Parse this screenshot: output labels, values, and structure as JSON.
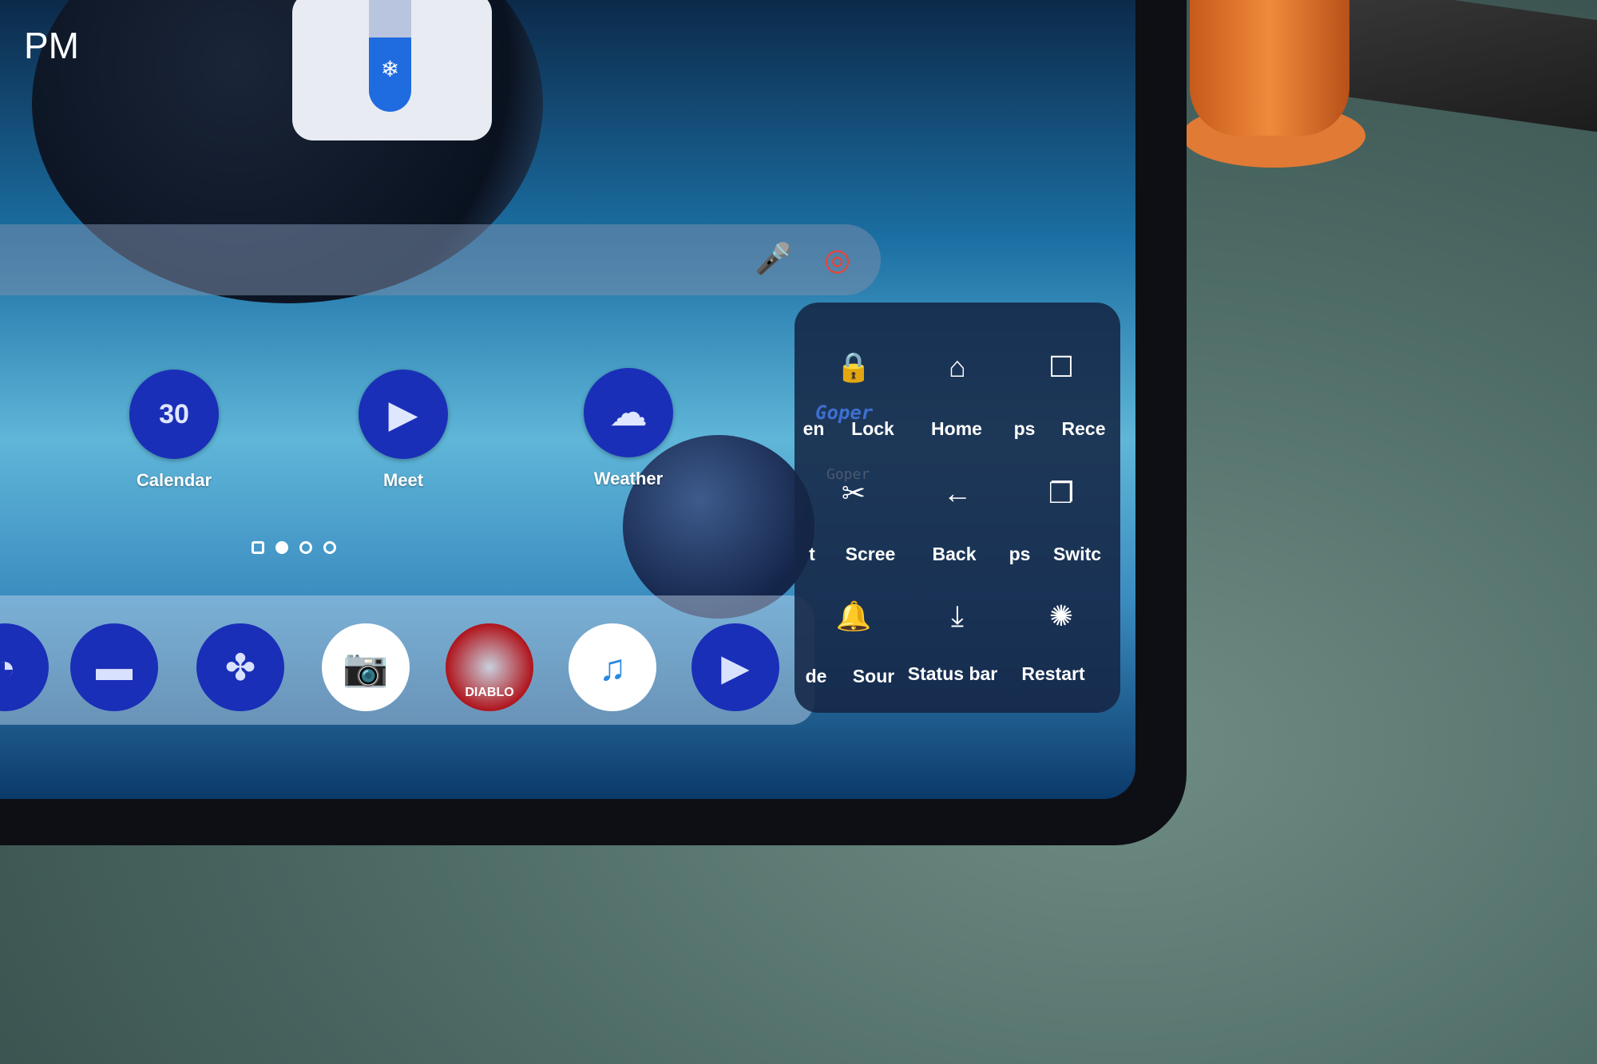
{
  "status": {
    "time_suffix": "PM"
  },
  "widget": {
    "icon_top": "leaf-icon",
    "icon_bottom": "snowflake-icon",
    "glyph": "❄"
  },
  "search": {
    "mic_icon": "microphone-icon",
    "lens_icon": "google-lens-icon",
    "mic_glyph": "🎤",
    "lens_glyph": "◎"
  },
  "apps": [
    {
      "label": "Calendar",
      "icon": "calendar-icon",
      "glyph": "30"
    },
    {
      "label": "Meet",
      "icon": "video-camera-icon",
      "glyph": "▶"
    },
    {
      "label": "Weather",
      "icon": "cloud-icon",
      "glyph": "☁"
    }
  ],
  "page_indicator": {
    "pages": 4,
    "current": 2
  },
  "dock": [
    {
      "icon": "chrome-icon",
      "glyph": "◔"
    },
    {
      "icon": "folder-icon",
      "glyph": "▬"
    },
    {
      "icon": "pinwheel-icon",
      "glyph": "✤"
    },
    {
      "icon": "camera-icon",
      "glyph": "📷"
    },
    {
      "icon": "diablo-game-icon",
      "glyph": "DIABLO"
    },
    {
      "icon": "app-folder-icon",
      "glyph": "♫"
    },
    {
      "icon": "youtube-icon",
      "glyph": "▶"
    }
  ],
  "panel": {
    "watermark": "Goper",
    "watermark2": "Goper",
    "items": [
      {
        "label": "Lock",
        "icon": "lock-icon",
        "glyph": "🔒"
      },
      {
        "label": "Home",
        "icon": "home-icon",
        "glyph": "⌂"
      },
      {
        "label": "Rece",
        "icon": "recents-square-icon",
        "glyph": "☐"
      },
      {
        "label": "Scree",
        "icon": "screenshot-scissors-icon",
        "glyph": "✂"
      },
      {
        "label": "Back",
        "icon": "back-arrow-icon",
        "glyph": "←"
      },
      {
        "label": "Switc",
        "icon": "switch-apps-icon",
        "glyph": "❐"
      },
      {
        "label": "Sour",
        "icon": "bell-icon",
        "glyph": "🔔"
      },
      {
        "label": "Status bar",
        "icon": "pull-down-status-bar-icon",
        "glyph": "⤓"
      },
      {
        "label": "Restart",
        "icon": "restart-spinner-icon",
        "glyph": "✺"
      }
    ],
    "partial_labels": [
      "en",
      "ps",
      "t",
      "ps",
      "de"
    ]
  }
}
